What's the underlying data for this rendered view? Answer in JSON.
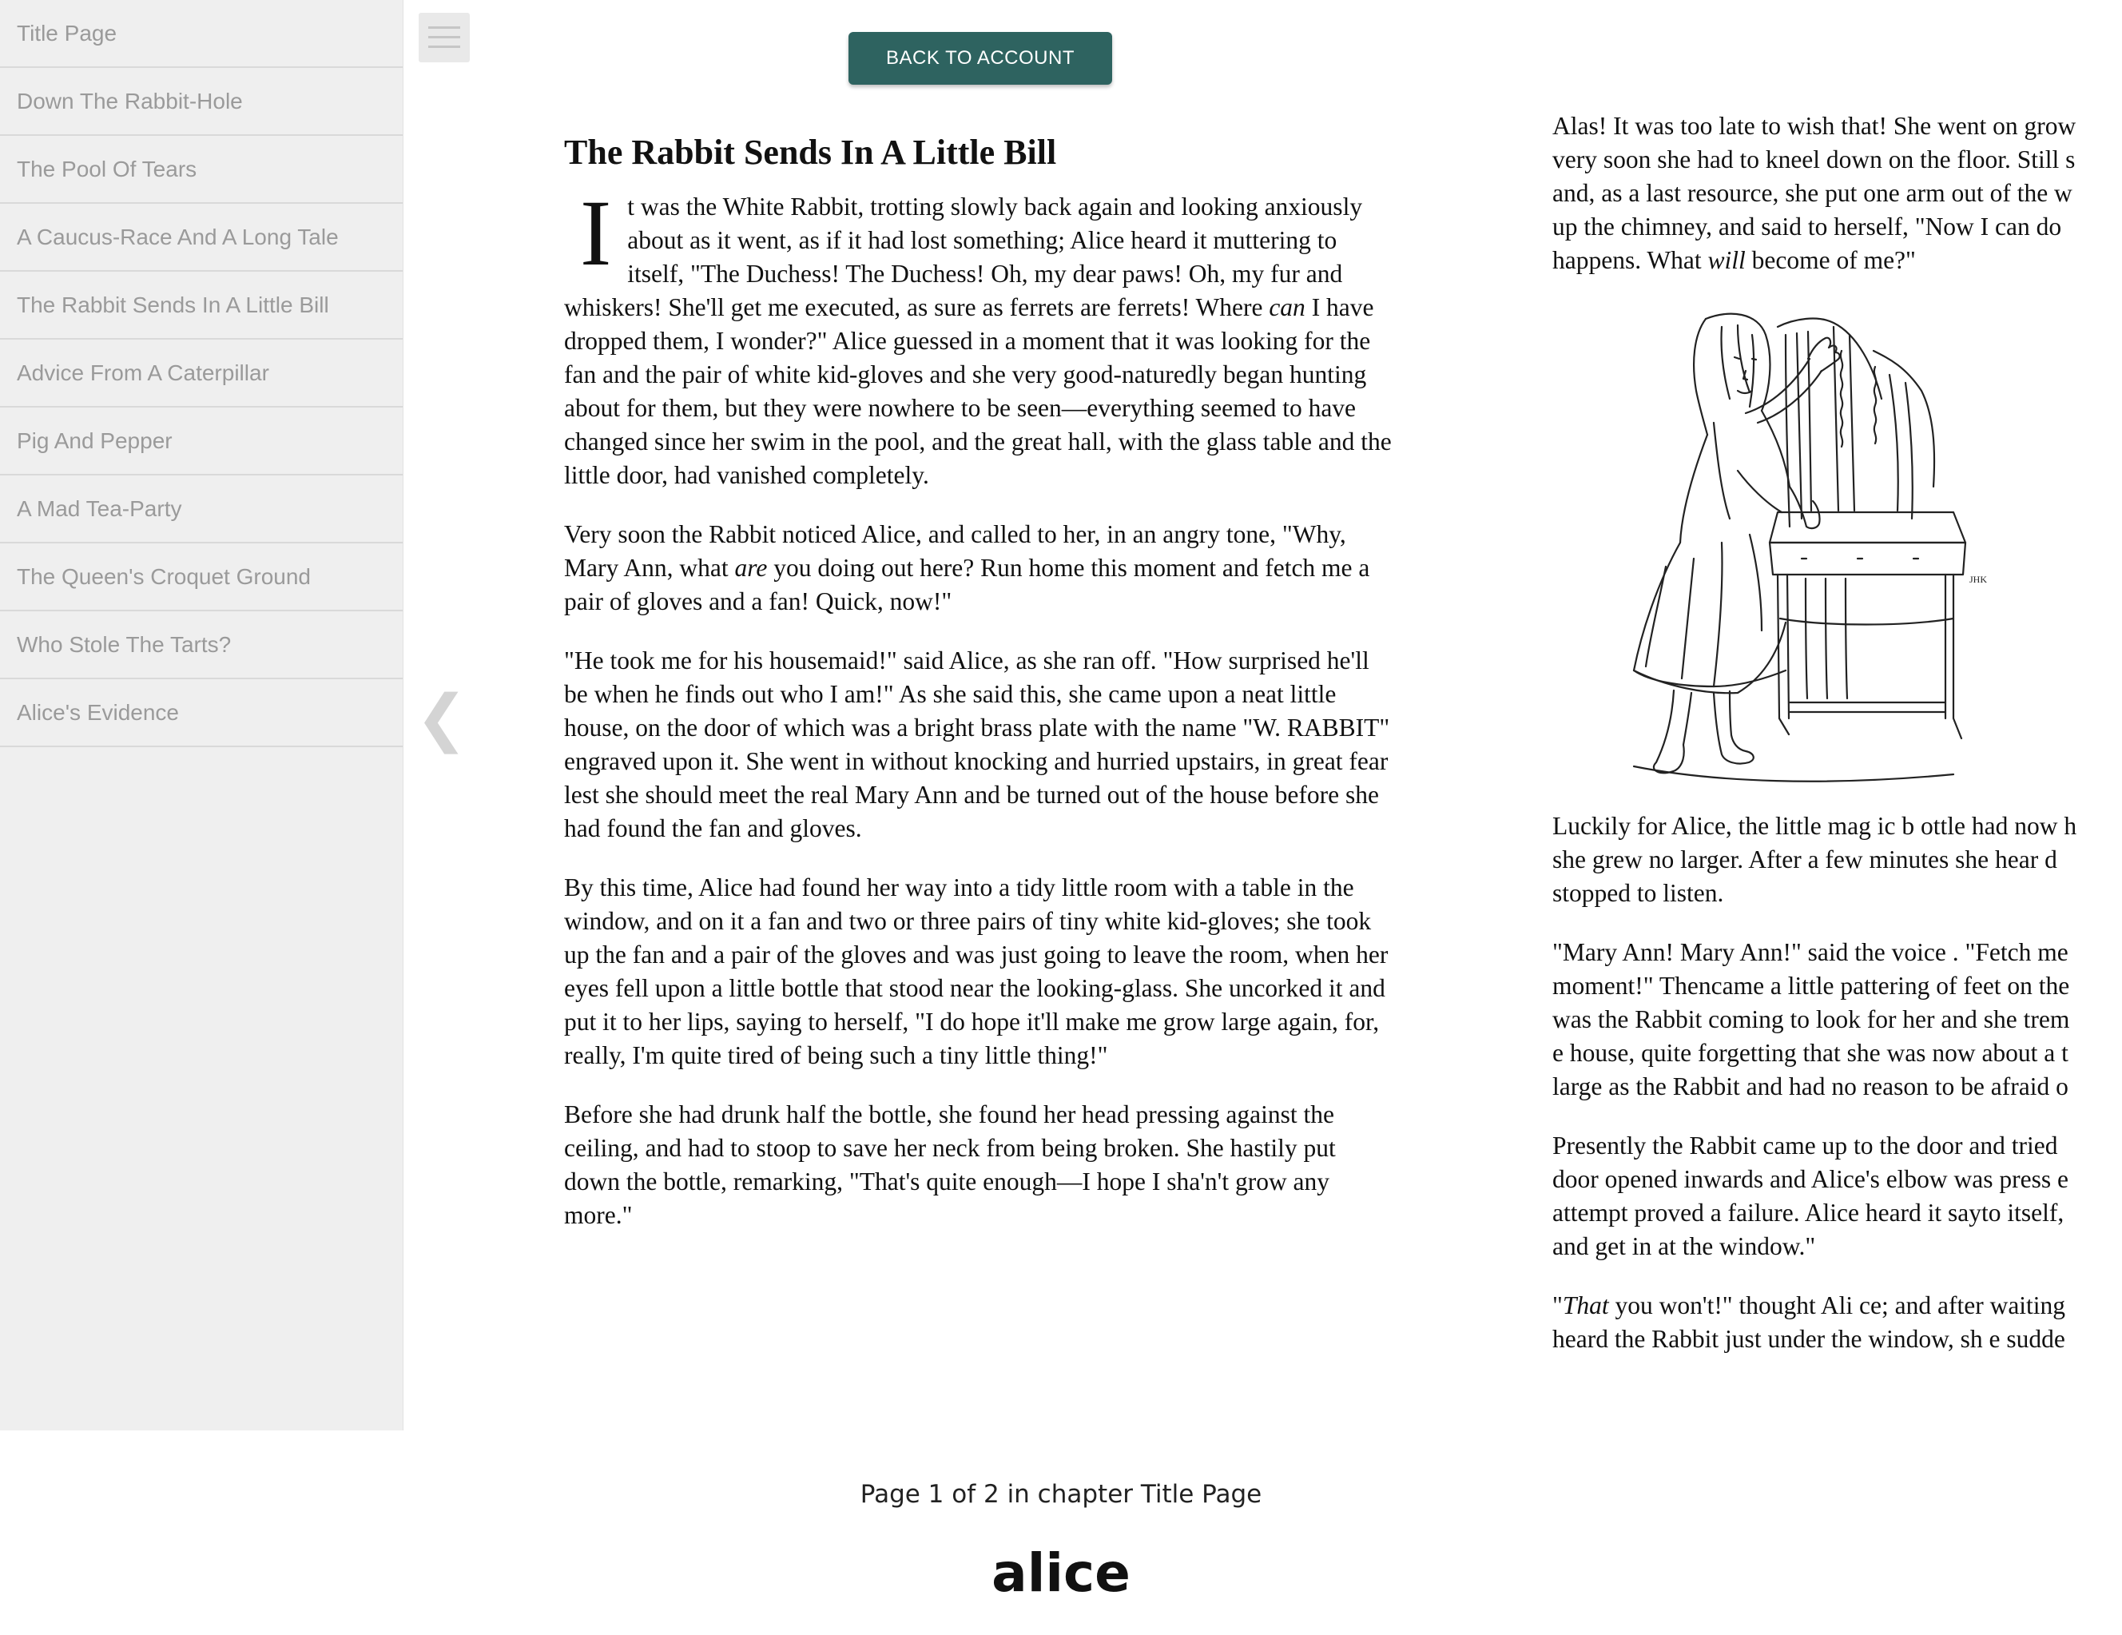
{
  "sidebar": {
    "items": [
      {
        "label": "Title Page"
      },
      {
        "label": "Down The Rabbit-Hole"
      },
      {
        "label": "The Pool Of Tears"
      },
      {
        "label": "A Caucus-Race And A Long Tale"
      },
      {
        "label": "The Rabbit Sends In A Little Bill"
      },
      {
        "label": "Advice From A Caterpillar"
      },
      {
        "label": "Pig And Pepper"
      },
      {
        "label": "A Mad Tea-Party"
      },
      {
        "label": "The Queen's Croquet Ground"
      },
      {
        "label": "Who Stole The Tarts?"
      },
      {
        "label": "Alice's Evidence"
      }
    ]
  },
  "toolbar": {
    "menu_icon": "hamburger-menu-icon",
    "back_label": "BACK TO ACCOUNT",
    "back_color": "#2e6360",
    "prev_icon": "chevron-left-icon",
    "prev_glyph": "❮"
  },
  "page_left": {
    "title": "The Rabbit Sends In A Little Bill",
    "dropcap": "I",
    "p1": {
      "a": "t was the White Rabbit, trotting slowly back again and looking anxiously about as it went, as if it had lost something; Alice heard it muttering to itself, \"The Duchess! The Duchess! Oh, my dear paws! Oh, my fur and whiskers! She'll get me executed, as sure as ferrets are ferrets! Where ",
      "em": "can",
      "b": " I have dropped them, I wonder?\" Alice guessed in a moment that it was looking for the fan and the pair of white kid-gloves and she very good-naturedly began hunting about for them, but they were nowhere to be seen—everything seemed to have changed since her swim in the pool, and the great hall, with the glass table and the little door, had vanished completely."
    },
    "p2": {
      "a": "Very soon the Rabbit noticed Alice, and called to her, in an angry tone, \"Why, Mary Ann, what ",
      "em": "are",
      "b": " you doing out here? Run home this moment and fetch me a pair of gloves and a fan! Quick, now!\""
    },
    "p3": "\"He took me for his housemaid!\" said Alice, as she ran off. \"How surprised he'll be when he finds out who I am!\" As she said this, she came upon a neat little house, on the door of which was a bright brass plate with the name \"W. RABBIT\" engraved upon it. She went in without knocking and hurried upstairs, in great fear lest she should meet the real Mary Ann and be turned out of the house before she had found the fan and gloves.",
    "p4": "By this time, Alice had found her way into a tidy little room with a table in the window, and on it a fan and two or three pairs of tiny white kid-gloves; she took up the fan and a pair of the gloves and was just going to leave the room, when her eyes fell upon a little bottle that stood near the looking-glass. She uncorked it and put it to her lips, saying to herself, \"I do hope it'll make me grow large again, for, really, I'm quite tired of being such a tiny little thing!\"",
    "p5": "Before she had drunk half the bottle, she found her head pressing against the ceiling, and had to stoop to save her neck from being broken. She hastily put down the bottle, remarking, \"That's quite enough—I hope I sha'n't grow any more.\""
  },
  "page_right": {
    "p1_lines": [
      {
        "t": "Alas! It was too late to wish that! She went on grow"
      },
      {
        "t": "very soon she had to kneel down on the floor. Still s"
      },
      {
        "t": "and, as a last resource, she put one arm out of the w"
      },
      {
        "t": "up the chimney, and said to herself, \"Now I can do "
      },
      {
        "a": "happens. What ",
        "em": "will",
        "b": " become of me?\""
      }
    ],
    "illustration_signature": "JHK",
    "p2_lines": [
      "Luckily for Alice, the little mag ic b ottle had now h",
      "she grew no larger. After a few minutes she hear d ",
      "stopped to listen."
    ],
    "p3_lines": [
      "\"Mary Ann! Mary Ann!\" said the voice . \"Fetch me ",
      "moment!\" Thencame a little pattering of feet on the",
      "was the Rabbit coming to look for her and she trem",
      "e house, quite forgetting that she was now about a t",
      "large as the Rabbit and had no reason to be afraid o"
    ],
    "p4_lines": [
      "Presently the Rabbit came up to the door and tried",
      "door opened inwards and Alice's elbow was press e",
      "attempt proved a failure. Alice heard it sayto itself,",
      "and get in at the window.\""
    ],
    "p5_lines": [
      {
        "a": "\"",
        "em": "That",
        "b": " you won't!\" thought Ali ce; and after waiting"
      },
      {
        "t": "heard the Rabbit just under the window, sh e sudde"
      }
    ]
  },
  "footer": {
    "status": "Page 1 of 2 in chapter Title Page",
    "brand": "alice"
  }
}
